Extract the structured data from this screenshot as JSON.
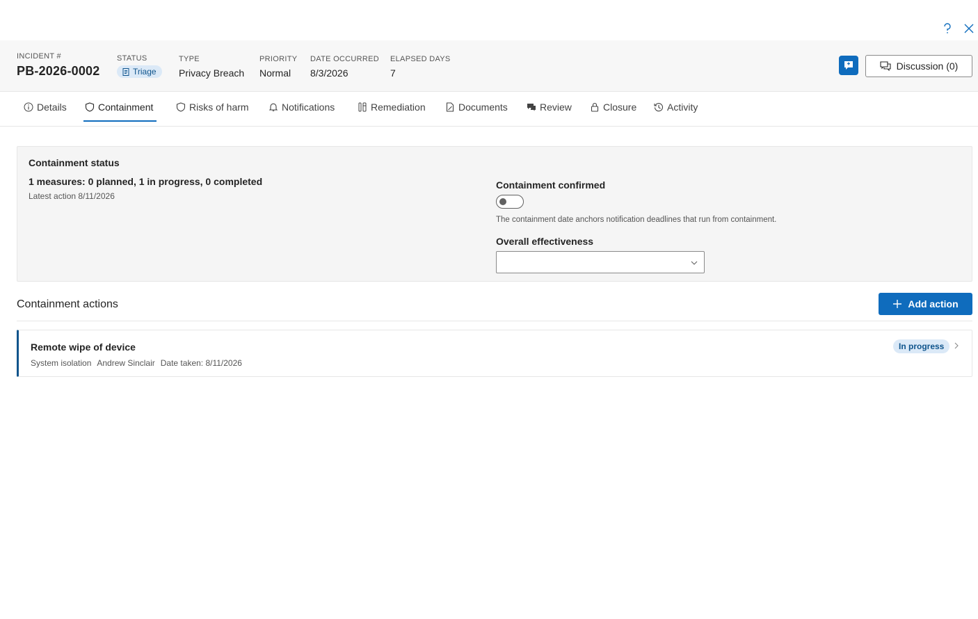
{
  "topbar": {
    "help_icon": "question-icon",
    "close_icon": "close-icon"
  },
  "header": {
    "incident": {
      "label": "INCIDENT #",
      "value": "PB-2026-0002"
    },
    "status": {
      "label": "STATUS",
      "value": "Triage"
    },
    "type": {
      "label": "TYPE",
      "value": "Privacy Breach"
    },
    "priority": {
      "label": "PRIORITY",
      "value": "Normal"
    },
    "date_occurred": {
      "label": "DATE OCCURRED",
      "value": "8/3/2026"
    },
    "elapsed_days": {
      "label": "ELAPSED DAYS",
      "value": "7"
    },
    "discussion_label": "Discussion (0)"
  },
  "tabs": [
    {
      "label": "Details",
      "icon": "info-icon"
    },
    {
      "label": "Containment",
      "icon": "shield-icon"
    },
    {
      "label": "Risks of harm",
      "icon": "shield-icon"
    },
    {
      "label": "Notifications",
      "icon": "bell-icon"
    },
    {
      "label": "Remediation",
      "icon": "tools-icon"
    },
    {
      "label": "Documents",
      "icon": "document-icon"
    },
    {
      "label": "Review",
      "icon": "chat-icon"
    },
    {
      "label": "Closure",
      "icon": "lock-icon"
    },
    {
      "label": "Activity",
      "icon": "history-icon"
    }
  ],
  "active_tab": "Containment",
  "containment_status": {
    "title": "Containment status",
    "measures": "1 measures: 0 planned, 1 in progress, 0 completed",
    "latest_action": "Latest action 8/11/2026",
    "confirmed_label": "Containment confirmed",
    "confirmed": false,
    "anchor_note": "The containment date anchors notification deadlines that run from containment.",
    "effectiveness_label": "Overall effectiveness",
    "effectiveness_value": ""
  },
  "actions": {
    "title": "Containment actions",
    "add_label": "Add action",
    "items": [
      {
        "name": "Remote wipe of device",
        "category": "System isolation",
        "owner": "Andrew Sinclair",
        "date": "Date taken: 8/11/2026",
        "status": "In progress"
      }
    ]
  },
  "colors": {
    "accent": "#0f6cbd",
    "badge_bg": "#dbe9f7",
    "badge_text": "#0f548c"
  }
}
